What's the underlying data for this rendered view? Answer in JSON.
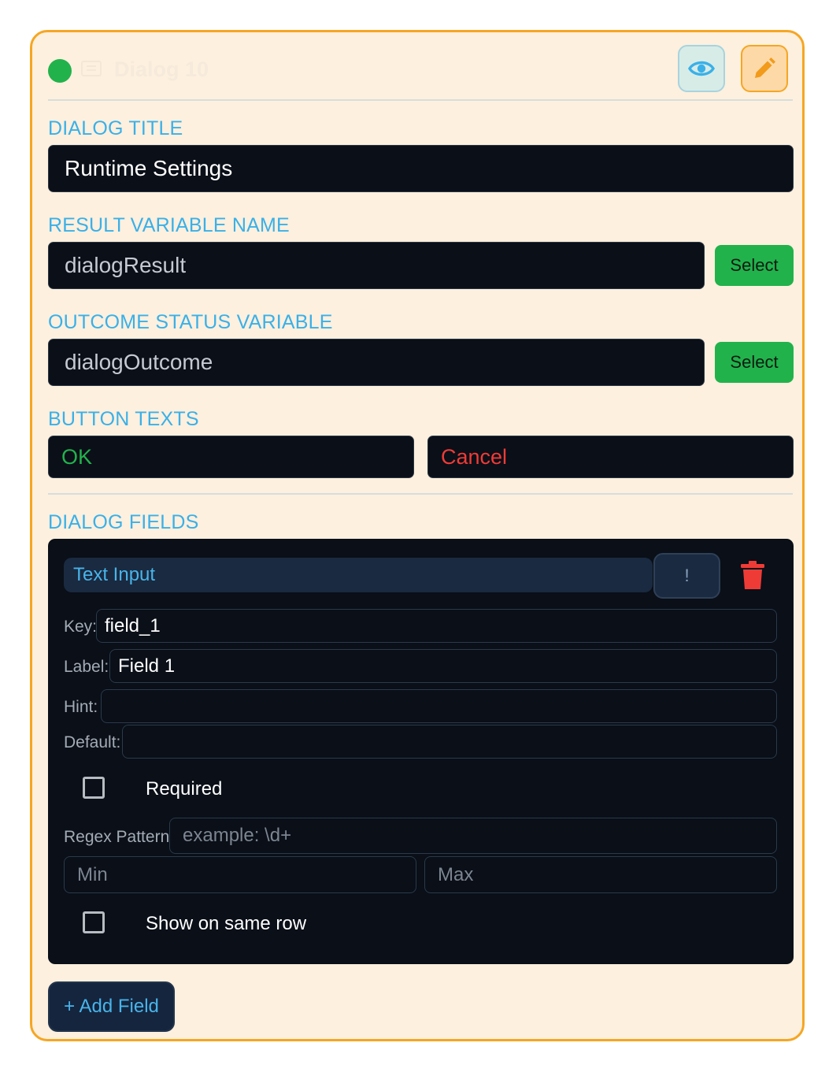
{
  "header": {
    "title": "Dialog 10",
    "status_color": "#22b24c",
    "icons": {
      "type": "dialog-icon",
      "preview": "eye-icon",
      "edit": "pencil-icon"
    }
  },
  "dialog_title": {
    "label": "DIALOG TITLE",
    "value": "Runtime Settings"
  },
  "result_variable": {
    "label": "RESULT VARIABLE NAME",
    "value": "dialogResult",
    "select_label": "Select"
  },
  "outcome_variable": {
    "label": "OUTCOME STATUS VARIABLE",
    "value": "dialogOutcome",
    "select_label": "Select"
  },
  "button_texts": {
    "label": "BUTTON TEXTS",
    "ok_value": "OK",
    "cancel_value": "Cancel",
    "ok_color": "#22b24c",
    "cancel_color": "#ef3b36"
  },
  "dialog_fields": {
    "label": "DIALOG FIELDS",
    "field": {
      "type": "Text Input",
      "bang_label": "!",
      "key_label": "Key:",
      "key_value": "field_1",
      "label_label": "Label:",
      "label_value": "Field 1",
      "hint_label": "Hint:",
      "hint_value": "",
      "default_label": "Default:",
      "default_value": "",
      "required_label": "Required",
      "regex_label": "Regex Pattern",
      "regex_placeholder": "example: \\d+",
      "min_placeholder": "Min",
      "max_placeholder": "Max",
      "same_row_label": "Show on same row"
    }
  },
  "add_field_label": "+ Add Field"
}
